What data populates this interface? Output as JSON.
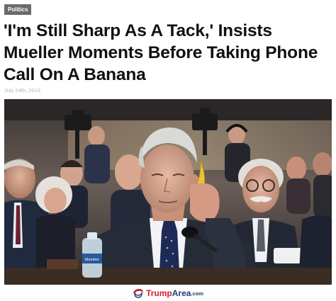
{
  "category": {
    "label": "Politics"
  },
  "article": {
    "headline_line1": "'I'm Still Sharp As A Tack,' Insists",
    "headline_line2": "Mueller Moments Before Taking Phone",
    "headline_line3": "Call On A Banana",
    "date": "July 24th, 2019"
  },
  "photo": {
    "bottle_label": "Member",
    "banana_color": "#e8c23a"
  },
  "brand": {
    "part1": "Trump",
    "part2": "Area",
    "part3": ".com",
    "icon": "trump-hair-icon",
    "red": "#d0202a",
    "navy": "#1f3b6e"
  }
}
